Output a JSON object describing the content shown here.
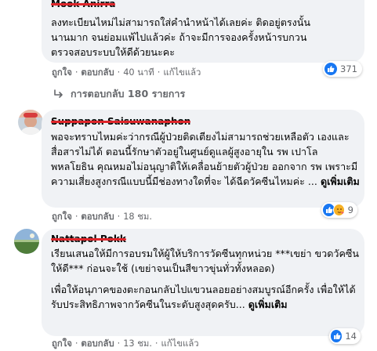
{
  "colors": {
    "bubble": "#f0f2f5",
    "meta_text": "#65676b",
    "like_blue": "#1877f2",
    "redaction_red": "#e0262b"
  },
  "actions": {
    "like": "ถูกใจ",
    "reply": "ตอบกลับ",
    "edited": "แก้ไขแล้ว",
    "see_more": "ดูเพิ่มเติม"
  },
  "comments": [
    {
      "author": "Mook Anirra",
      "lines": [
        "ลงทะเบียนไหม่ไม่สามารถใส่คำนำหน้าได้เลยค่ะ ติดอยู่ตรงนั้น",
        "นานมาก จนย่อมแพ้ไปแล้วค่ะ ถ้าจะมีการจองครั้งหน้ารบกวน",
        "ตรวจสอบระบบให้ดีด้วยนะคะ"
      ],
      "time": "40 นาที",
      "reaction_count": "371",
      "reactions": [
        "like-icon"
      ],
      "view_replies": "การตอบกลับ 180 รายการ"
    },
    {
      "author": "Suppapon Saisuwanaphon",
      "paragraphs": [
        "พอจะทราบไหมค่ะว่ากรณีผู้ป่วยติดเตียงไม่สามารถช่วยเหลือตัว เองและสื่อสารไม่ได้ ตอนนี้รักษาตัวอยู่ในศูนย์ดูแลผู้สูงอายุใน รพ เปาโล พหลโยธิน คุณหมอไม่อนุญาติให้เคลื่อนย้ายตัวผู้ป่วย ออกจาก รพ เพราะมีความเสี่ยงสูงกรณีแบบนี้มีช่องทางใดที่จะ ได้ฉีดวัคซีนไหมค่ะ ..."
      ],
      "time": "18 ชม.",
      "reaction_count": "9",
      "reactions": [
        "like-icon",
        "care-icon"
      ]
    },
    {
      "author": "Nattapol Pokk",
      "paragraphs": [
        "เรียนเสนอให้มีการอบรมให้ผู้ให้บริการวัดซีนทุกหน่วย ***เขย่า ขวดวัคซีนให้ดี*** ก่อนจะใช้ (เขย่าจนเป็นสีขาวขุ่นทั่วทั้งหลอด)",
        "เพื่อให้อนุภาคของตะกอนกลับไปแขวนลอยอย่างสมบูรณ์อีกครั้ง เพื่อให้ได้รับประสิทธิภาพจากวัคซีนในระดับสูงสุดครับ..."
      ],
      "time": "13 ชม.",
      "reaction_count": "14",
      "reactions": [
        "like-icon"
      ]
    }
  ]
}
